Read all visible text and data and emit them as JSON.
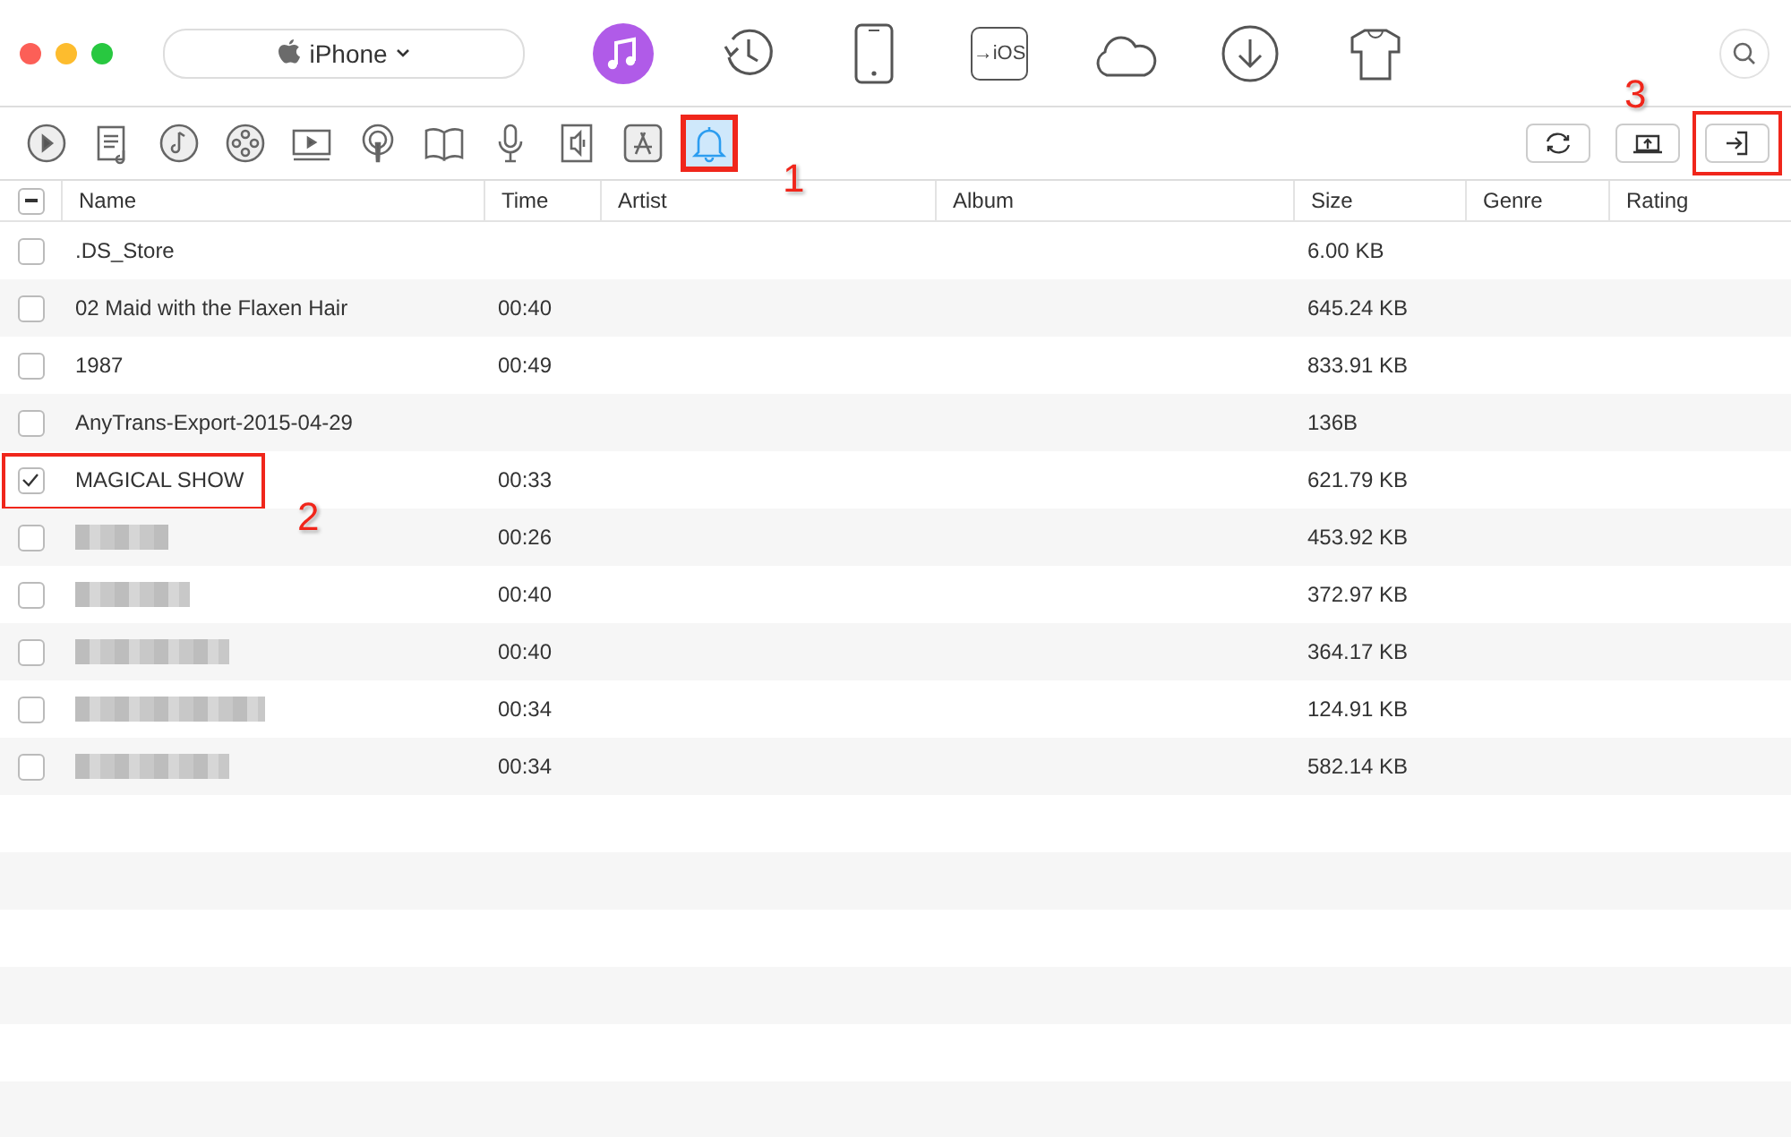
{
  "device": {
    "name": "iPhone"
  },
  "nav": [
    {
      "selected": true
    },
    {
      "selected": false
    },
    {
      "selected": false
    },
    {
      "selected": false,
      "label": "→iOS"
    },
    {
      "selected": false
    },
    {
      "selected": false
    },
    {
      "selected": false
    }
  ],
  "categories": [
    {
      "selected": false,
      "highlighted": false
    },
    {
      "selected": false,
      "highlighted": false
    },
    {
      "selected": false,
      "highlighted": false
    },
    {
      "selected": false,
      "highlighted": false
    },
    {
      "selected": false,
      "highlighted": false
    },
    {
      "selected": false,
      "highlighted": false
    },
    {
      "selected": false,
      "highlighted": false
    },
    {
      "selected": false,
      "highlighted": false
    },
    {
      "selected": false,
      "highlighted": false
    },
    {
      "selected": false,
      "highlighted": false
    },
    {
      "selected": true,
      "highlighted": true,
      "callout": "1"
    }
  ],
  "actions": [
    {
      "highlighted": false
    },
    {
      "highlighted": false,
      "callout": "3"
    },
    {
      "highlighted": true
    }
  ],
  "table": {
    "select_all_partial": true,
    "columns": [
      "Name",
      "Time",
      "Artist",
      "Album",
      "Size",
      "Genre",
      "Rating"
    ],
    "rows": [
      {
        "checked": false,
        "name": ".DS_Store",
        "time": "",
        "size": "6.00 KB",
        "redacted": false
      },
      {
        "checked": false,
        "name": "02 Maid with the Flaxen Hair",
        "time": "00:40",
        "size": "645.24 KB",
        "redacted": false
      },
      {
        "checked": false,
        "name": "1987",
        "time": "00:49",
        "size": "833.91 KB",
        "redacted": false
      },
      {
        "checked": false,
        "name": "AnyTrans-Export-2015-04-29",
        "time": "",
        "size": "136B",
        "redacted": false
      },
      {
        "checked": true,
        "name": "MAGICAL SHOW",
        "time": "00:33",
        "size": "621.79 KB",
        "redacted": false,
        "highlighted": true,
        "callout": "2"
      },
      {
        "checked": false,
        "time": "00:26",
        "size": "453.92 KB",
        "redacted": true
      },
      {
        "checked": false,
        "time": "00:40",
        "size": "372.97 KB",
        "redacted": true
      },
      {
        "checked": false,
        "time": "00:40",
        "size": "364.17 KB",
        "redacted": true
      },
      {
        "checked": false,
        "time": "00:34",
        "size": "124.91 KB",
        "redacted": true
      },
      {
        "checked": false,
        "time": "00:34",
        "size": "582.14 KB",
        "redacted": true
      }
    ]
  }
}
